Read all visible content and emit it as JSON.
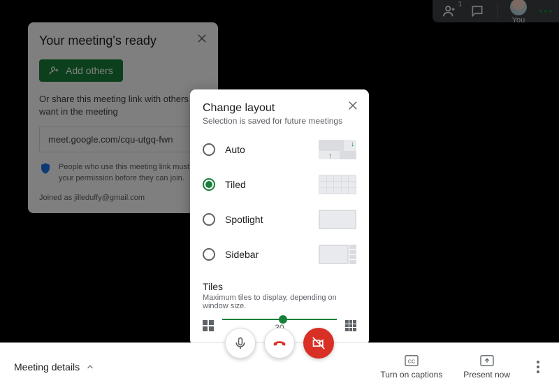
{
  "topbar": {
    "participant_count": "1",
    "you_label": "You"
  },
  "ready": {
    "title": "Your meeting's ready",
    "add_others": "Add others",
    "share_text": "Or share this meeting link with others you want in the meeting",
    "link": "meet.google.com/cqu-utgq-fwn",
    "permission_text": "People who use this meeting link must get your permission before they can join.",
    "joined_as": "Joined as jilleduffy@gmail.com"
  },
  "modal": {
    "title": "Change layout",
    "subtitle": "Selection is saved for future meetings",
    "options": {
      "auto": "Auto",
      "tiled": "Tiled",
      "spotlight": "Spotlight",
      "sidebar": "Sidebar"
    },
    "selected": "tiled",
    "tiles_heading": "Tiles",
    "tiles_desc": "Maximum tiles to display, depending on window size.",
    "slider_value": "30",
    "slider_pct": 53
  },
  "bottombar": {
    "meeting_details": "Meeting details",
    "captions": "Turn on captions",
    "present": "Present now"
  }
}
